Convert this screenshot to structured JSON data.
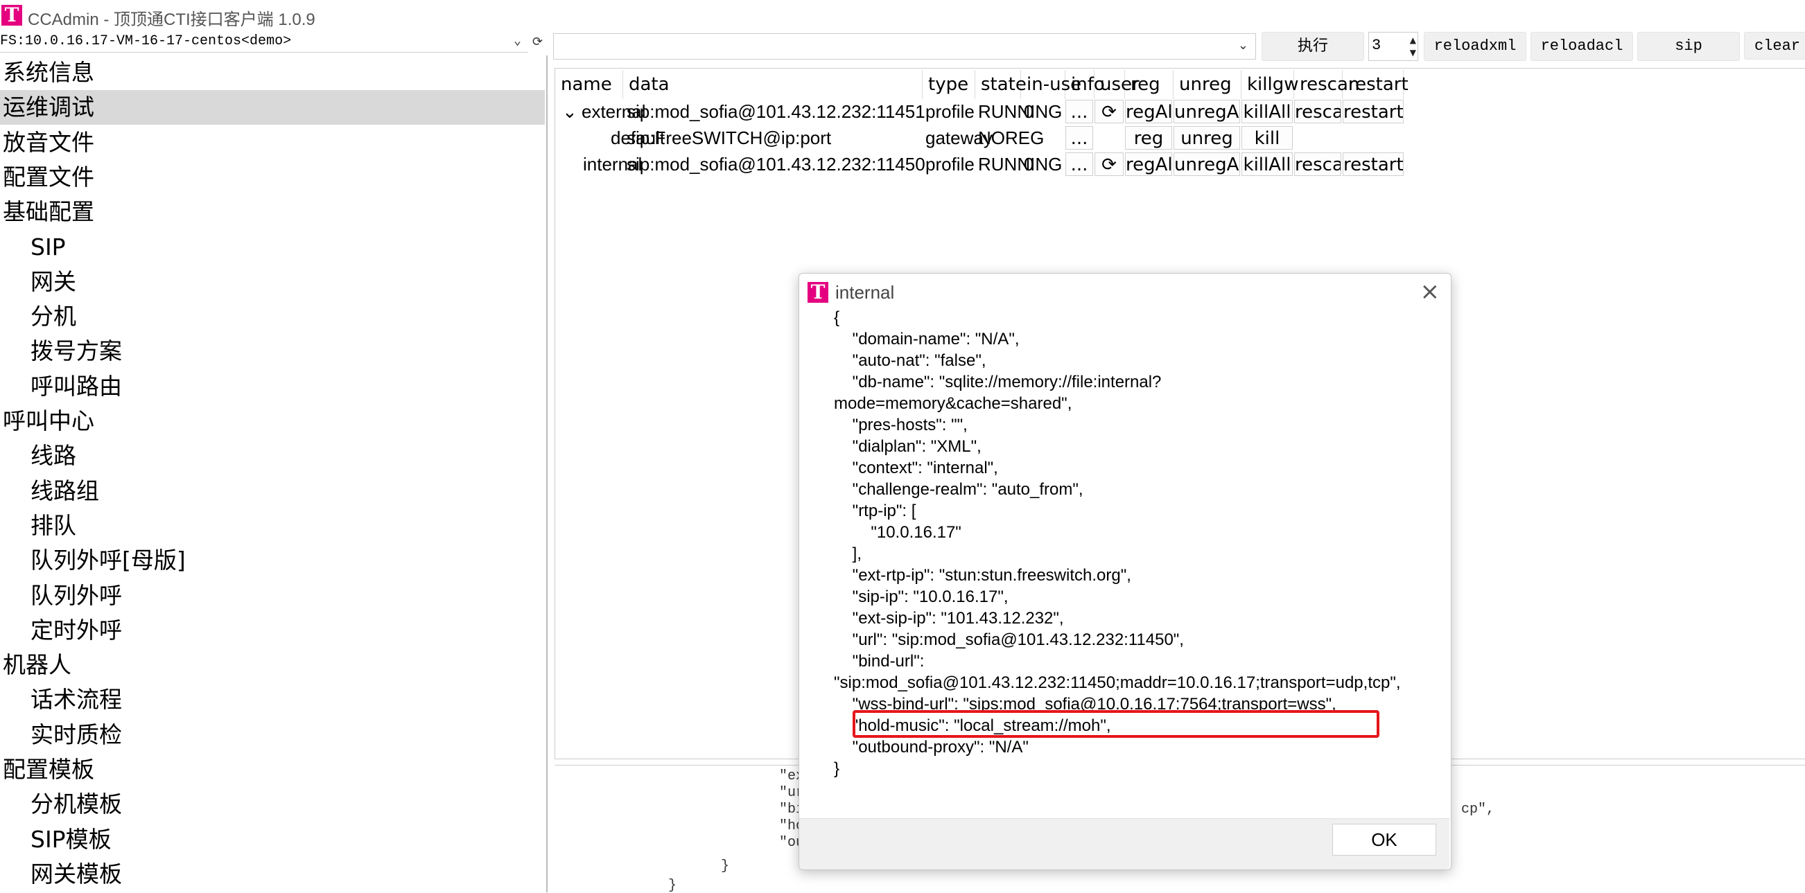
{
  "window": {
    "title": "CCAdmin - 顶顶通CTI接口客户端 1.0.9",
    "logo": "T"
  },
  "fs": {
    "selected": "FS:10.0.16.17-VM-16-17-centos<demo>"
  },
  "sidebar": {
    "items": [
      {
        "label": "系统信息",
        "level": 0
      },
      {
        "label": "运维调试",
        "level": 0,
        "selected": true
      },
      {
        "label": "放音文件",
        "level": 0
      },
      {
        "label": "配置文件",
        "level": 0
      },
      {
        "label": "基础配置",
        "level": 0
      },
      {
        "label": "SIP",
        "level": 1
      },
      {
        "label": "网关",
        "level": 1
      },
      {
        "label": "分机",
        "level": 1
      },
      {
        "label": "拨号方案",
        "level": 1
      },
      {
        "label": "呼叫路由",
        "level": 1
      },
      {
        "label": "呼叫中心",
        "level": 0
      },
      {
        "label": "线路",
        "level": 1
      },
      {
        "label": "线路组",
        "level": 1
      },
      {
        "label": "排队",
        "level": 1
      },
      {
        "label": "队列外呼[母版]",
        "level": 1
      },
      {
        "label": "队列外呼",
        "level": 1
      },
      {
        "label": "定时外呼",
        "level": 1
      },
      {
        "label": "机器人",
        "level": 0
      },
      {
        "label": "话术流程",
        "level": 1
      },
      {
        "label": "实时质检",
        "level": 1
      },
      {
        "label": "配置模板",
        "level": 0
      },
      {
        "label": "分机模板",
        "level": 1
      },
      {
        "label": "SIP模板",
        "level": 1
      },
      {
        "label": "网关模板",
        "level": 1
      }
    ]
  },
  "toolbar": {
    "command_value": "",
    "execute_label": "执行",
    "spin_value": "3",
    "reloadxml_label": "reloadxml",
    "reloadacl_label": "reloadacl",
    "sip_label": "sip",
    "clear_label": "clear"
  },
  "grid": {
    "columns": [
      "name",
      "data",
      "type",
      "state",
      "in-use",
      "info",
      "user",
      "reg",
      "unreg",
      "killgw",
      "rescan",
      "restart"
    ],
    "rows": [
      {
        "expander": "⌄",
        "name": "external",
        "data": "sip:mod_sofia@101.43.12.232:11451",
        "type": "profile",
        "state": "RUNNING",
        "inuse": "0",
        "info": "...",
        "user": "⟳",
        "reg": "regAll",
        "unreg": "unregAll",
        "killgw": "killAll",
        "rescan": "rescan",
        "restart": "restart"
      },
      {
        "expander": "",
        "name": "default",
        "data": "sip:FreeSWITCH@ip:port",
        "type": "gateway",
        "state": "NOREG",
        "inuse": "",
        "info": "...",
        "user": "",
        "reg": "reg",
        "unreg": "unreg",
        "killgw": "kill",
        "rescan": "",
        "restart": ""
      },
      {
        "expander": "",
        "name": "internal",
        "data": "sip:mod_sofia@101.43.12.232:11450",
        "type": "profile",
        "state": "RUNNING",
        "inuse": "0",
        "info": "...",
        "user": "⟳",
        "reg": "regAll",
        "unreg": "unregAll",
        "killgw": "killAll",
        "rescan": "rescan",
        "restart": "restart"
      }
    ]
  },
  "log": {
    "lines": [
      "\"ex",
      "\"ur",
      "\"bi",
      "\"ho",
      "\"ou",
      "}",
      "}"
    ],
    "tail": "cp\","
  },
  "dialog": {
    "title": "internal",
    "close_icon": "×",
    "ok_label": "OK",
    "json_lines": [
      "{",
      "    \"domain-name\": \"N/A\",",
      "    \"auto-nat\": \"false\",",
      "    \"db-name\": \"sqlite://memory://file:internal?",
      "mode=memory&cache=shared\",",
      "    \"pres-hosts\": \"\",",
      "    \"dialplan\": \"XML\",",
      "    \"context\": \"internal\",",
      "    \"challenge-realm\": \"auto_from\",",
      "    \"rtp-ip\": [",
      "        \"10.0.16.17\"",
      "    ],",
      "    \"ext-rtp-ip\": \"stun:stun.freeswitch.org\",",
      "    \"sip-ip\": \"10.0.16.17\",",
      "    \"ext-sip-ip\": \"101.43.12.232\",",
      "    \"url\": \"sip:mod_sofia@101.43.12.232:11450\",",
      "    \"bind-url\":",
      "\"sip:mod_sofia@101.43.12.232:11450;maddr=10.0.16.17;transport=udp,tcp\",",
      "    \"wss-bind-url\": \"sips:mod_sofia@10.0.16.17:7564;transport=wss\",",
      "    \"hold-music\": \"local_stream://moh\",",
      "    \"outbound-proxy\": \"N/A\"",
      "}"
    ]
  },
  "colors": {
    "brand": "#e4007f",
    "highlight": "#e5161b",
    "selected_bg": "#d9d9d9"
  }
}
